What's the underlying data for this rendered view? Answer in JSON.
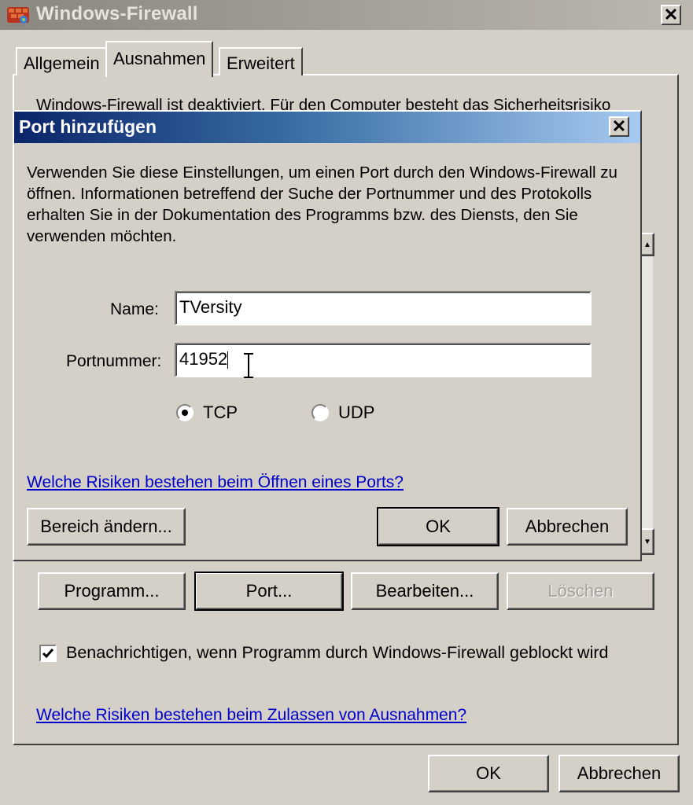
{
  "window": {
    "title": "Windows-Firewall",
    "close_glyph": "✕"
  },
  "tabs": [
    {
      "label": "Allgemein",
      "selected": false
    },
    {
      "label": "Ausnahmen",
      "selected": true
    },
    {
      "label": "Erweitert",
      "selected": false
    }
  ],
  "behind_text": "Windows-Firewall ist deaktiviert. Für den Computer besteht das Sicherheitsrisiko",
  "dialog": {
    "title": "Port hinzufügen",
    "close_glyph": "✕",
    "description": "Verwenden Sie diese Einstellungen, um einen Port durch den Windows-Firewall zu öffnen. Informationen betreffend der Suche der Portnummer und des Protokolls erhalten Sie in der Dokumentation des Programms bzw. des Diensts, den Sie verwenden möchten.",
    "name_label": "Name:",
    "name_value": "TVersity",
    "port_label": "Portnummer:",
    "port_value": "41952",
    "protocol_tcp": "TCP",
    "protocol_udp": "UDP",
    "selected_protocol": "TCP",
    "risk_link": "Welche Risiken bestehen beim Öffnen eines Ports?",
    "scope_button": "Bereich ändern...",
    "ok_button": "OK",
    "cancel_button": "Abbrechen"
  },
  "main": {
    "program_button": "Programm...",
    "port_button": "Port...",
    "edit_button": "Bearbeiten...",
    "delete_button": "Löschen",
    "notify_label": "Benachrichtigen, wenn Programm durch Windows-Firewall geblockt wird",
    "notify_checked": true,
    "risk_link": "Welche Risiken bestehen beim Zulassen von Ausnahmen?",
    "ok_button": "OK",
    "cancel_button": "Abbrechen"
  },
  "icons": {
    "app": "firewall-icon",
    "text_cursor": "ibeam-cursor-icon"
  }
}
